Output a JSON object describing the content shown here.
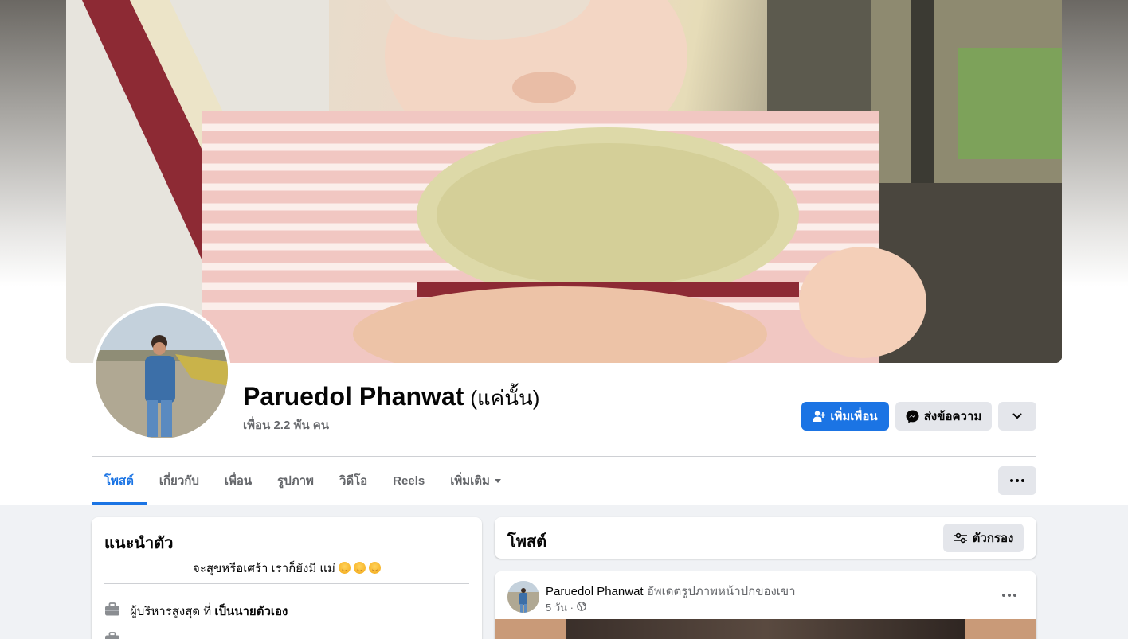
{
  "profile": {
    "name": "Paruedol Phanwat",
    "alternate_name": "(แค่นั้น)",
    "friends_count": "เพื่อน 2.2 พัน คน"
  },
  "actions": {
    "add_friend_label": "เพิ่มเพื่อน",
    "message_label": "ส่งข้อความ"
  },
  "tabs": [
    {
      "label": "โพสต์",
      "active": true
    },
    {
      "label": "เกี่ยวกับ"
    },
    {
      "label": "เพื่อน"
    },
    {
      "label": "รูปภาพ"
    },
    {
      "label": "วิดีโอ"
    },
    {
      "label": "Reels"
    },
    {
      "label": "เพิ่มเติม"
    }
  ],
  "intro": {
    "title": "แนะนำตัว",
    "bio": "จะสุขหรือเศร้า เราก็ยังมี แม่",
    "work_prefix": "ผู้บริหารสูงสุด ที่",
    "work_place": "เป็นนายตัวเอง"
  },
  "posts": {
    "title": "โพสต์",
    "filter_label": "ตัวกรอง",
    "first": {
      "author": "Paruedol Phanwat",
      "action": "อัพเดตรูปภาพหน้าปกของเขา",
      "time": "5 วัน ·"
    }
  },
  "icons": {
    "add_friend": "person-plus-icon",
    "message": "messenger-icon",
    "chevron": "chevron-down-icon",
    "more": "more-dots-icon",
    "filter": "filter-sliders-icon",
    "work": "briefcase-icon",
    "privacy": "globe-icon"
  },
  "colors": {
    "accent": "#1b74e4",
    "secondary_text": "#65676b",
    "background": "#f0f2f5"
  }
}
